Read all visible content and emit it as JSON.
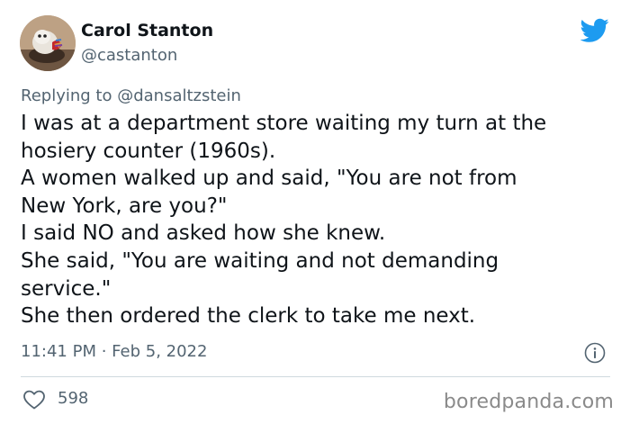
{
  "author": {
    "display_name": "Carol Stanton",
    "handle": "@castanton",
    "avatar_icon": "dog-photo-avatar"
  },
  "platform_icon": "twitter-bird-icon",
  "reply": {
    "prefix": "Replying to",
    "mention": "@dansaltzstein"
  },
  "body_lines": [
    "I was at a department store waiting my turn at the",
    "hosiery counter (1960s).",
    "A women walked up and said, \"You are not from",
    "New York, are you?\"",
    "I said NO and asked how she knew.",
    "She said, \"You are waiting and not demanding",
    "service.\"",
    "She then ordered the clerk to take me next."
  ],
  "timestamp": "11:41 PM · Feb 5, 2022",
  "likes": "598",
  "watermark": "boredpanda.com",
  "colors": {
    "brand_blue": "#1d9bf0",
    "secondary_text": "#536471",
    "primary_text": "#0f1419",
    "divider": "#cfd9de"
  }
}
